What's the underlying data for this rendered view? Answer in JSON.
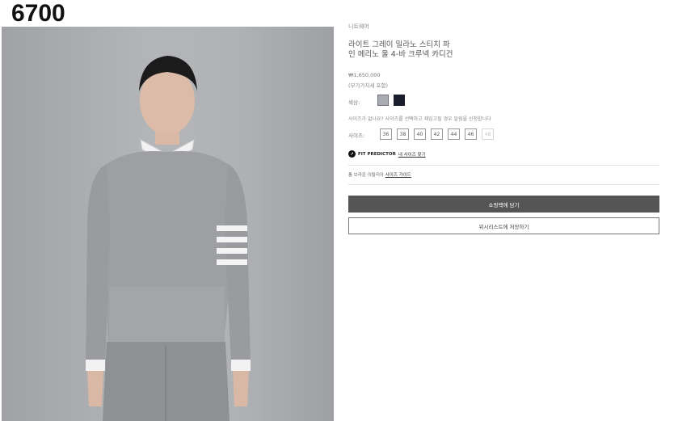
{
  "overlay": {
    "number": "6700"
  },
  "breadcrumb": {
    "text": "니트웨어"
  },
  "product": {
    "title": "라이트 그레이 밀라노 스티치 파인 메리노 울 4-바 크루넥 카디건",
    "price": "₩1,650,000",
    "vat_note": "(부가가치세 포함)"
  },
  "color": {
    "label": "색상:",
    "options": [
      {
        "name": "light-gray",
        "hex": "#a9acb2",
        "selected": true
      },
      {
        "name": "navy",
        "hex": "#1a1e2c",
        "selected": false
      }
    ]
  },
  "size": {
    "note": "사이즈가 없나요? 사이즈를 선택하고 재입고될 경우 알림을 신청합니다",
    "label": "사이즈:",
    "options": [
      {
        "label": "36",
        "available": true
      },
      {
        "label": "38",
        "available": true
      },
      {
        "label": "40",
        "available": true
      },
      {
        "label": "42",
        "available": true
      },
      {
        "label": "44",
        "available": true
      },
      {
        "label": "46",
        "available": true
      },
      {
        "label": "48",
        "available": false
      }
    ]
  },
  "fit_predictor": {
    "brand": "FIT PREDICTOR",
    "link": "내 사이즈 찾기"
  },
  "size_guide": {
    "prefix": "톰 브라운 이탈리아",
    "link": "사이즈 가이드"
  },
  "buttons": {
    "add_to_bag": "쇼핑백에 담기",
    "wishlist": "위시리스트에 저장하기"
  },
  "colors": {
    "primary_button": "#555555",
    "background": "#ffffff"
  }
}
